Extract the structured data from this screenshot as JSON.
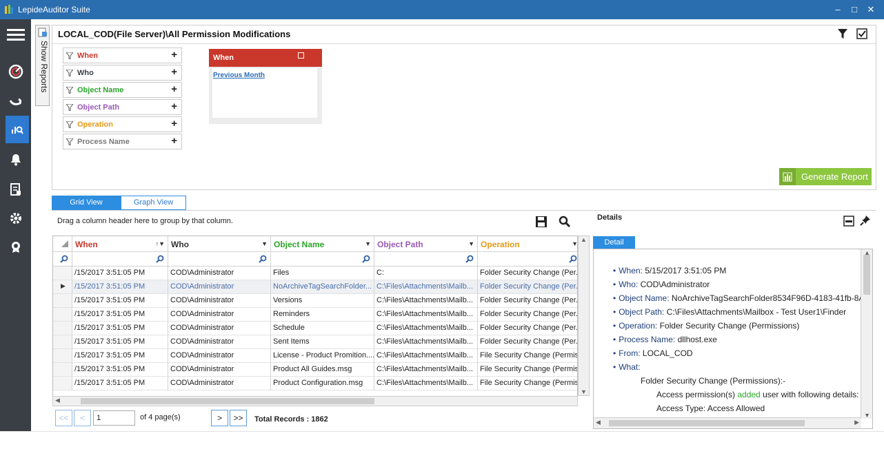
{
  "window": {
    "title": "LepideAuditor Suite",
    "min_label": "‒",
    "max_label": "□",
    "close_label": "✕"
  },
  "sidebar": {
    "show_reports_label": "Show Reports",
    "items": [
      "menu-icon",
      "dashboard-icon",
      "radar-icon",
      "audit-reports-icon",
      "alerts-icon",
      "report-doc-icon",
      "settings-icon",
      "license-icon"
    ]
  },
  "report": {
    "title": "LOCAL_COD(File Server)\\All Permission Modifications",
    "filters": [
      {
        "label": "When",
        "color": "#c9382b"
      },
      {
        "label": "Who",
        "color": "#3a3f45"
      },
      {
        "label": "Object Name",
        "color": "#2aa52a"
      },
      {
        "label": "Object Path",
        "color": "#9b59b6"
      },
      {
        "label": "Operation",
        "color": "#e59a17"
      },
      {
        "label": "Process Name",
        "color": "#7a7a7a"
      }
    ],
    "when_card": {
      "title": "When",
      "value": "Previous Month"
    },
    "generate_label": "Generate Report"
  },
  "views": {
    "grid_label": "Grid View",
    "graph_label": "Graph View"
  },
  "grid": {
    "group_hint": "Drag a column header here to group by that column.",
    "columns": [
      {
        "label": "When",
        "color": "#c9382b"
      },
      {
        "label": "Who",
        "color": "#333333"
      },
      {
        "label": "Object Name",
        "color": "#2aa52a"
      },
      {
        "label": "Object Path",
        "color": "#9b59b6"
      },
      {
        "label": "Operation",
        "color": "#e59a17"
      }
    ],
    "rows": [
      [
        "/15/2017 3:51:05 PM",
        "COD\\Administrator",
        "Files",
        "C:",
        "Folder Security Change (Per..."
      ],
      [
        "/15/2017 3:51:05 PM",
        "COD\\Administrator",
        "NoArchiveTagSearchFolder...",
        "C:\\Files\\Attachments\\Mailb...",
        "Folder Security Change (Per..."
      ],
      [
        "/15/2017 3:51:05 PM",
        "COD\\Administrator",
        "Versions",
        "C:\\Files\\Attachments\\Mailb...",
        "Folder Security Change (Per..."
      ],
      [
        "/15/2017 3:51:05 PM",
        "COD\\Administrator",
        "Reminders",
        "C:\\Files\\Attachments\\Mailb...",
        "Folder Security Change (Per..."
      ],
      [
        "/15/2017 3:51:05 PM",
        "COD\\Administrator",
        "Schedule",
        "C:\\Files\\Attachments\\Mailb...",
        "Folder Security Change (Per..."
      ],
      [
        "/15/2017 3:51:05 PM",
        "COD\\Administrator",
        "Sent Items",
        "C:\\Files\\Attachments\\Mailb...",
        "Folder Security Change (Per..."
      ],
      [
        "/15/2017 3:51:05 PM",
        "COD\\Administrator",
        "License - Product Promition....",
        "C:\\Files\\Attachments\\Mailb...",
        "File Security Change (Permis..."
      ],
      [
        "/15/2017 3:51:05 PM",
        "COD\\Administrator",
        "Product All Guides.msg",
        "C:\\Files\\Attachments\\Mailb...",
        "File Security Change (Permis..."
      ],
      [
        "/15/2017 3:51:05 PM",
        "COD\\Administrator",
        "Product Configuration.msg",
        "C:\\Files\\Attachments\\Mailb...",
        "File Security Change (Permis..."
      ]
    ],
    "selected_row": 1
  },
  "pager": {
    "first": "<<",
    "prev": "<",
    "page": "1",
    "of_pages": "of 4 page(s)",
    "next": ">",
    "last": ">>",
    "total": "Total Records : 1862"
  },
  "details": {
    "title": "Details",
    "tab": "Detail",
    "lines": [
      {
        "label": "When:",
        "value": "5/15/2017 3:51:05 PM"
      },
      {
        "label": "Who:",
        "value": "COD\\Administrator"
      },
      {
        "label": "Object Name:",
        "value": "NoArchiveTagSearchFolder8534F96D-4183-41fb-8A("
      },
      {
        "label": "Object Path:",
        "value": "C:\\Files\\Attachments\\Mailbox - Test User1\\Finder"
      },
      {
        "label": "Operation:",
        "value": "Folder Security Change (Permissions)"
      },
      {
        "label": "Process Name:",
        "value": "dllhost.exe"
      },
      {
        "label": "From:",
        "value": "LOCAL_COD"
      },
      {
        "label": "What:",
        "value": ""
      }
    ],
    "what_heading": "Folder Security Change (Permissions):-",
    "what_line_pre": "Access permission(s) ",
    "what_line_added": "added",
    "what_line_post": " user with following details:",
    "what_line_cut": "Access Type: Access Allowed"
  }
}
